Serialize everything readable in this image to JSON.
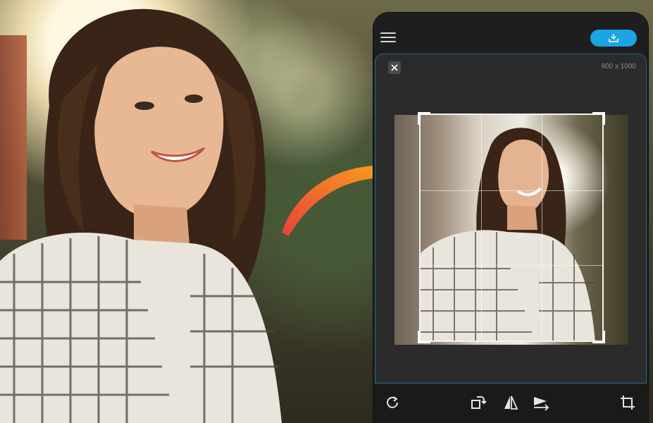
{
  "editor": {
    "dimensions_label": "800 x 1000"
  },
  "icons": {
    "menu": "menu-icon",
    "save": "download-icon",
    "close": "close-icon",
    "rotate": "rotate-icon",
    "rotate_layer": "rotate-layer-icon",
    "flip": "flip-icon",
    "straighten": "straighten-icon",
    "crop": "crop-icon"
  },
  "colors": {
    "accent": "#1aa6e4",
    "arrow_start": "#e8413b",
    "arrow_end": "#f7a11a",
    "panel": "#2b2b2c",
    "toolbar": "#1a1a1b"
  }
}
